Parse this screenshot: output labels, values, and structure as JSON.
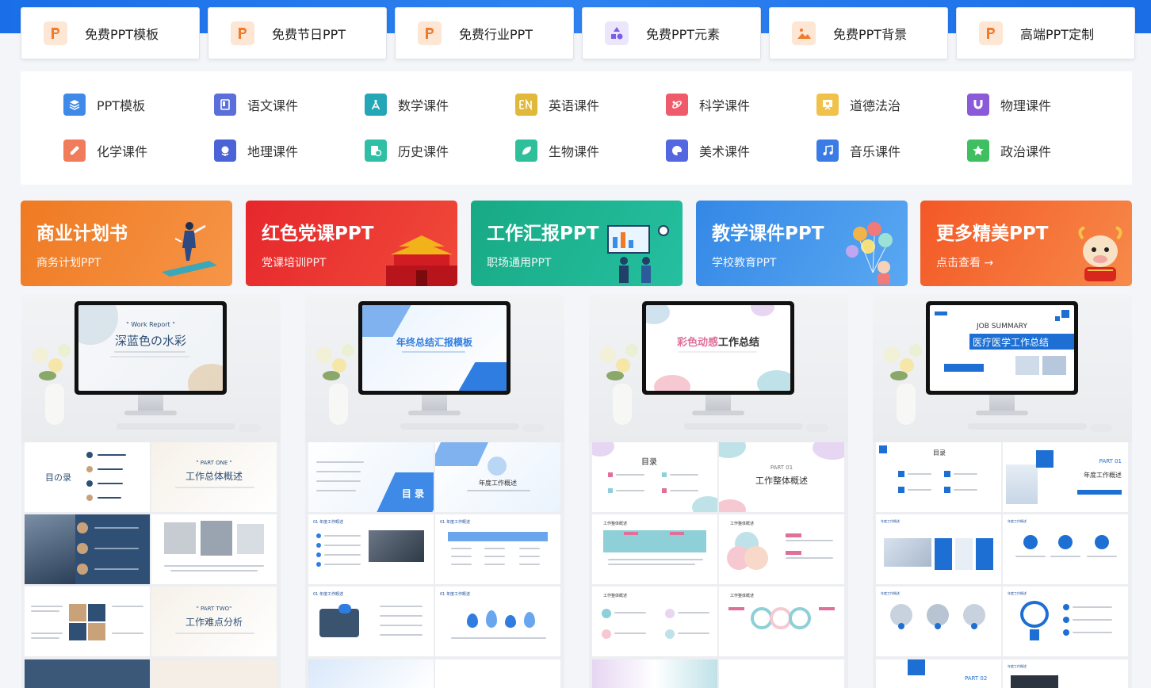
{
  "tabs": [
    {
      "label": "免费PPT模板",
      "icon": "ppt-icon",
      "color": "#f39c4e"
    },
    {
      "label": "免费节日PPT",
      "icon": "ppt-icon",
      "color": "#f39c4e"
    },
    {
      "label": "免费行业PPT",
      "icon": "ppt-icon",
      "color": "#f39c4e"
    },
    {
      "label": "免费PPT元素",
      "icon": "shapes-icon",
      "color": "#7b5de8"
    },
    {
      "label": "免费PPT背景",
      "icon": "image-icon",
      "color": "#f39c4e"
    },
    {
      "label": "高端PPT定制",
      "icon": "ppt-icon",
      "color": "#f39c4e"
    }
  ],
  "categories": [
    {
      "label": "PPT模板",
      "icon": "layers-icon",
      "color": "#3f8ae8"
    },
    {
      "label": "语文课件",
      "icon": "book-icon",
      "color": "#5a6fd9"
    },
    {
      "label": "数学课件",
      "icon": "compass-icon",
      "color": "#23a6b6"
    },
    {
      "label": "英语课件",
      "icon": "en-icon",
      "color": "#e0b83a"
    },
    {
      "label": "科学课件",
      "icon": "atom-icon",
      "color": "#ef5b6b"
    },
    {
      "label": "道德法治",
      "icon": "board-icon",
      "color": "#f0c24a"
    },
    {
      "label": "物理课件",
      "icon": "magnet-icon",
      "color": "#8b5ad8"
    },
    {
      "label": "化学课件",
      "icon": "flask-icon",
      "color": "#f07c5b"
    },
    {
      "label": "地理课件",
      "icon": "globe-icon",
      "color": "#4a63d6"
    },
    {
      "label": "历史课件",
      "icon": "history-icon",
      "color": "#2fbfa4"
    },
    {
      "label": "生物课件",
      "icon": "leaf-icon",
      "color": "#2fbf9a"
    },
    {
      "label": "美术课件",
      "icon": "palette-icon",
      "color": "#5367e0"
    },
    {
      "label": "音乐课件",
      "icon": "music-icon",
      "color": "#3a7be6"
    },
    {
      "label": "政治课件",
      "icon": "star-icon",
      "color": "#3fbf5f"
    }
  ],
  "banners": [
    {
      "title": "商业计划书",
      "subtitle": "商务计划PPT",
      "bg": "#f07a25"
    },
    {
      "title": "红色党课PPT",
      "subtitle": "党课培训PPT",
      "bg": "#e42b2f"
    },
    {
      "title": "工作汇报PPT",
      "subtitle": "职场通用PPT",
      "bg": "#1fae8c"
    },
    {
      "title": "教学课件PPT",
      "subtitle": "学校教育PPT",
      "bg": "#3a8de8"
    },
    {
      "title": "更多精美PPT",
      "subtitle": "点击查看 →",
      "bg": "#f3622a"
    }
  ],
  "templates": [
    {
      "screen_kicker": "\" Work Report \"",
      "screen_title": "深蓝色の水彩",
      "theme": "#2f4f75",
      "accent": "#c9a27a",
      "thumbs": [
        "目の录",
        "\" PART ONE \"",
        "工作总体概述",
        "",
        "",
        "\" PART TWO\"",
        "工作难点分析"
      ]
    },
    {
      "screen_title": "年终总结汇报模板",
      "theme": "#2f7de0",
      "accent": "#8fc1f2",
      "thumbs": [
        "目 录",
        "年度工作概述",
        "01 年度工作概述",
        "01 年度工作概述",
        "01 年度工作概述",
        "01 年度工作概述"
      ]
    },
    {
      "screen_title_a": "彩色动感",
      "screen_title_b": "工作总结",
      "theme": "#e06f9a",
      "accent": "#8ecfd8",
      "thumbs": [
        "目录",
        "PART 01",
        "工作整体概述",
        "工作整体概述",
        "工作整体概述",
        "工作整体概述",
        "工作整体概述"
      ]
    },
    {
      "screen_kicker": "JOB SUMMARY",
      "screen_title": "医疗医学工作总结",
      "theme": "#1d6fd3",
      "accent": "#1d6fd3",
      "thumbs": [
        "目录",
        "PART 01",
        "年度工作概述",
        "年度工作概述",
        "年度工作概述",
        "年度工作概述",
        "年度工作概述",
        "PART 02"
      ]
    }
  ]
}
